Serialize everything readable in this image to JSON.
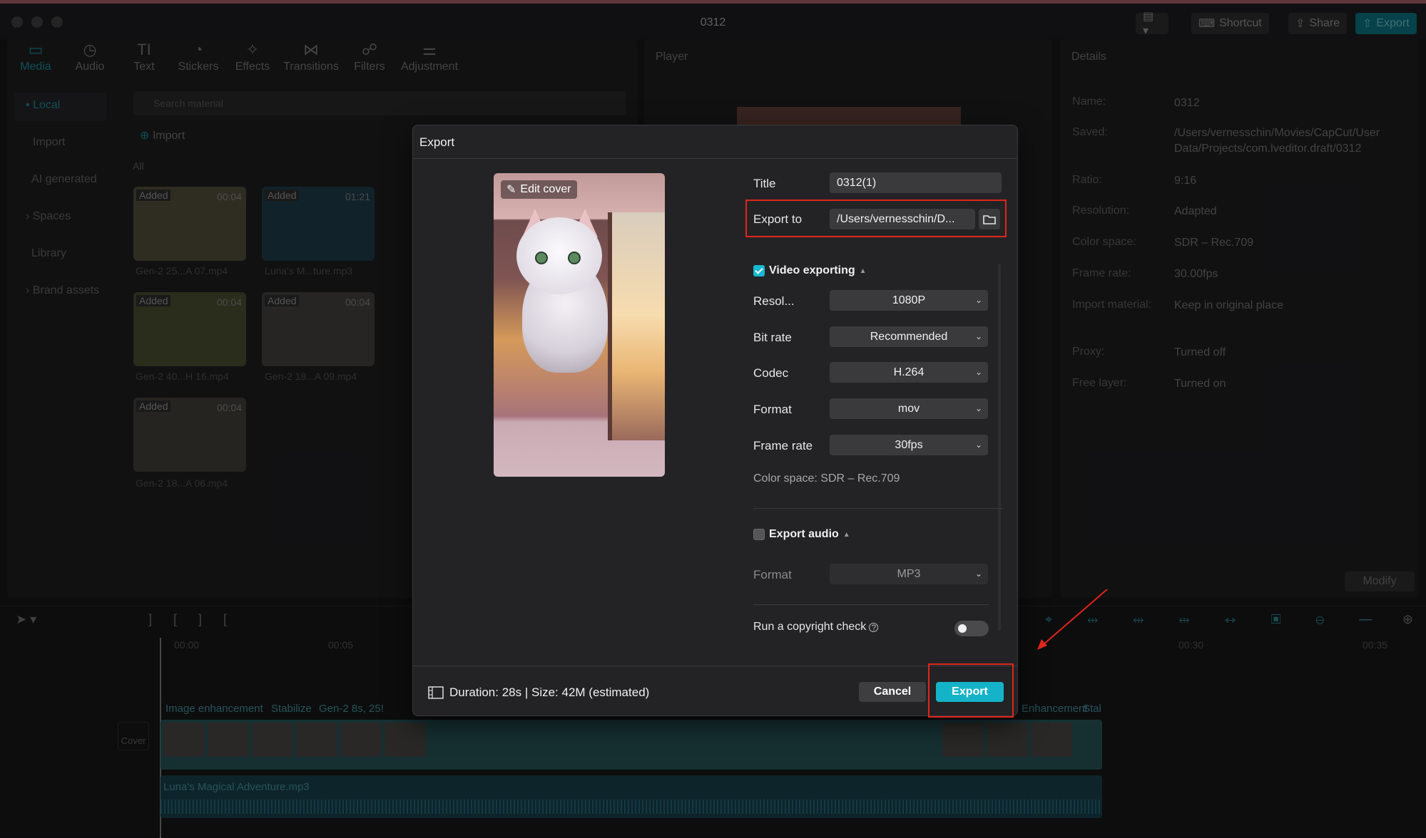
{
  "window": {
    "title": "0312"
  },
  "toolbar": {
    "shortcut": "Shortcut",
    "share": "Share",
    "export": "Export"
  },
  "tabs": [
    {
      "label": "Media",
      "icon": "▭"
    },
    {
      "label": "Audio",
      "icon": "◷"
    },
    {
      "label": "Text",
      "icon": "TI"
    },
    {
      "label": "Stickers",
      "icon": "◔"
    },
    {
      "label": "Effects",
      "icon": "✧"
    },
    {
      "label": "Transitions",
      "icon": "⋈"
    },
    {
      "label": "Filters",
      "icon": "☍"
    },
    {
      "label": "Adjustment",
      "icon": "⚌"
    }
  ],
  "sidebar": {
    "items": [
      "• Local",
      "Import",
      "AI generated",
      "› Spaces",
      "Library",
      "› Brand assets"
    ]
  },
  "media": {
    "search_placeholder": "Search material",
    "import": "Import",
    "filter": "All",
    "thumbs": [
      {
        "badge": "Added",
        "duration": "00:04",
        "name": "Gen-2 25...A 07.mp4"
      },
      {
        "badge": "Added",
        "duration": "01:21",
        "name": "Luna's M...ture.mp3"
      },
      {
        "badge": "Added",
        "duration": "00:04",
        "name": "Gen-2 40...H 16.mp4"
      },
      {
        "badge": "Added",
        "duration": "00:04",
        "name": "Gen-2 18...A 09.mp4"
      },
      {
        "badge": "Added",
        "duration": "00:04",
        "name": "Gen-2 18...A 06.mp4"
      }
    ]
  },
  "player": {
    "title": "Player"
  },
  "details": {
    "title": "Details",
    "rows": [
      {
        "label": "Name:",
        "value": "0312"
      },
      {
        "label": "Saved:",
        "value": "/Users/vernesschin/Movies/CapCut/User Data/Projects/com.lveditor.draft/0312"
      },
      {
        "label": "Ratio:",
        "value": "9:16"
      },
      {
        "label": "Resolution:",
        "value": "Adapted"
      },
      {
        "label": "Color space:",
        "value": "SDR – Rec.709"
      },
      {
        "label": "Frame rate:",
        "value": "30.00fps"
      },
      {
        "label": "Import material:",
        "value": "Keep in original place"
      },
      {
        "label": "Proxy:",
        "value": "Turned off"
      },
      {
        "label": "Free layer:",
        "value": "Turned on"
      }
    ],
    "modify": "Modify"
  },
  "timeline": {
    "ticks": [
      "00:00",
      "00:05",
      "00:30",
      "00:35"
    ],
    "clip_labels": [
      "Image enhancement",
      "Stabilize",
      "Gen-2 8s, 25!",
      "Enhancement",
      "Stal"
    ],
    "cover": "Cover",
    "audio_name": "Luna's Magical Adventure.mp3"
  },
  "dialog": {
    "title": "Export",
    "edit_cover": "Edit cover",
    "title_label": "Title",
    "title_value": "0312(1)",
    "export_to_label": "Export to",
    "export_to_value": "/Users/vernesschin/D...",
    "video_section": "Video exporting",
    "resolution_label": "Resol...",
    "resolution_value": "1080P",
    "bitrate_label": "Bit rate",
    "bitrate_value": "Recommended",
    "codec_label": "Codec",
    "codec_value": "H.264",
    "format_label": "Format",
    "format_value": "mov",
    "framerate_label": "Frame rate",
    "framerate_value": "30fps",
    "colorspace": "Color space: SDR – Rec.709",
    "audio_section": "Export audio",
    "audio_format_label": "Format",
    "audio_format_value": "MP3",
    "copyright_label": "Run a copyright check",
    "footer_info": "Duration: 28s | Size: 42M (estimated)",
    "cancel": "Cancel",
    "export": "Export"
  },
  "colors": {
    "accent": "#15b3c8",
    "highlight": "#e0251b"
  }
}
